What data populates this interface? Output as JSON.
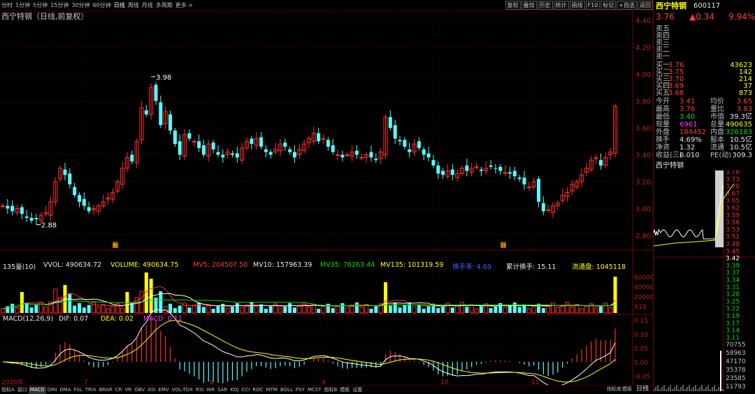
{
  "toolbar": {
    "periods": [
      "分时",
      "1分钟",
      "5分钟",
      "15分钟",
      "30分钟",
      "60分钟",
      "日线",
      "周线",
      "月线",
      "多周期",
      "更多 >"
    ],
    "active_period": "日线",
    "right_buttons": [
      "复权",
      "叠加",
      "历史",
      "统计",
      "画线",
      "F10",
      "标记",
      "+自选",
      "返回"
    ]
  },
  "main_chart": {
    "title": "西宁特钢（日线,前复权）",
    "price_labels": [
      "4.40",
      "4.20",
      "4.00",
      "3.80",
      "3.60",
      "3.40",
      "3.20",
      "3.00",
      "2.80"
    ],
    "high_marker": "3.98",
    "low_marker": "2.88",
    "month_labels": [
      "2020年",
      "7",
      "8",
      "9",
      "10",
      "11"
    ],
    "event_markers": [
      "融",
      "财"
    ]
  },
  "volume": {
    "legend": {
      "label": "135量(10)",
      "vvol": "VVOL: 490634.72",
      "volume": "VOLUME: 490634.75",
      "mv5": "MV5: 204507.50",
      "mv10": "MV10: 157963.39",
      "mv35": "MV35: 76263.44",
      "mv135": "MV135: 101319.59",
      "turnover": "换手率: 4.69",
      "cum_turnover": "累计换手: 15.11",
      "float_shares": "流通盘: 1045118"
    },
    "axis_labels": [
      "60000",
      "40000",
      "20000",
      "X10"
    ]
  },
  "macd": {
    "legend": {
      "label": "MACD(12,26,9)",
      "dif": "DIF: 0.07",
      "dea": "DEA: 0.02",
      "macd": "MACD: 0.11"
    },
    "axis_labels": [
      "0.15",
      "0.10",
      "0.05",
      "0.00",
      "-0.05"
    ]
  },
  "bottom": {
    "indicators": [
      "指标A",
      "窗口",
      "MACD",
      "DMI",
      "DMA",
      "FSL",
      "TRIX",
      "BRAR",
      "CR",
      "VR",
      "OBV",
      "ASI",
      "EMV",
      "VOL-TDX",
      "RSI",
      "WR",
      "SAR",
      "KDJ",
      "CCI",
      "ROC",
      "MTM",
      "BOLL",
      "PSY",
      "MCST",
      "指标B",
      "模板",
      "设置"
    ],
    "active_indicator": "MACD",
    "right_tabs": [
      "指标库",
      "模板"
    ],
    "period_label": "日线"
  },
  "quote": {
    "name": "西宁特钢",
    "code": "600117",
    "price": "3.76",
    "change": "▲0.34",
    "change_pct": "9.94%",
    "asks": [
      {
        "label": "卖五",
        "price": "",
        "vol": ""
      },
      {
        "label": "卖四",
        "price": "",
        "vol": ""
      },
      {
        "label": "卖三",
        "price": "",
        "vol": ""
      },
      {
        "label": "卖二",
        "price": "",
        "vol": ""
      },
      {
        "label": "卖一",
        "price": "",
        "vol": ""
      }
    ],
    "bids": [
      {
        "label": "买一",
        "price": "3.76",
        "vol": "43623"
      },
      {
        "label": "买二",
        "price": "3.75",
        "vol": "142"
      },
      {
        "label": "买三",
        "price": "3.70",
        "vol": "214"
      },
      {
        "label": "买四",
        "price": "3.69",
        "vol": "37"
      },
      {
        "label": "买五",
        "price": "3.68",
        "vol": "873"
      }
    ],
    "stats": [
      {
        "l1": "今开",
        "v1": "3.41",
        "l2": "均价",
        "v2": "3.65"
      },
      {
        "l1": "最高",
        "v1": "3.76",
        "l2": "量比",
        "v2": "3.83"
      },
      {
        "l1": "最低",
        "v1": "3.40",
        "l2": "市值",
        "v2": "39.3亿"
      },
      {
        "l1": "现量",
        "v1": "6961",
        "l2": "总量",
        "v2": "490635"
      },
      {
        "l1": "外盘",
        "v1": "184452",
        "l2": "内盘",
        "v2": "326183"
      },
      {
        "l1": "换手",
        "v1": "4.69%",
        "l2": "股本",
        "v2": "10.5亿"
      },
      {
        "l1": "净资",
        "v1": "1.32",
        "l2": "流通",
        "v2": "10.5亿"
      },
      {
        "l1": "收益(三)",
        "v1": "0.010",
        "l2": "PE(动)",
        "v2": "309.3"
      }
    ],
    "mini_title": "西宁特钢",
    "mini_price_labels": [
      "3.76",
      "3.73",
      "3.70",
      "3.67",
      "3.65",
      "3.62",
      "3.59",
      "3.56",
      "3.53",
      "3.51",
      "3.48",
      "3.45",
      "3.42",
      "3.39",
      "3.37",
      "3.34",
      "3.31",
      "3.28",
      "3.25",
      "3.22",
      "3.19",
      "3.17",
      "3.14",
      "3.11"
    ],
    "mini_vol_labels": [
      "70755",
      "58963",
      "47170",
      "35378",
      "23585",
      "11793"
    ]
  }
}
